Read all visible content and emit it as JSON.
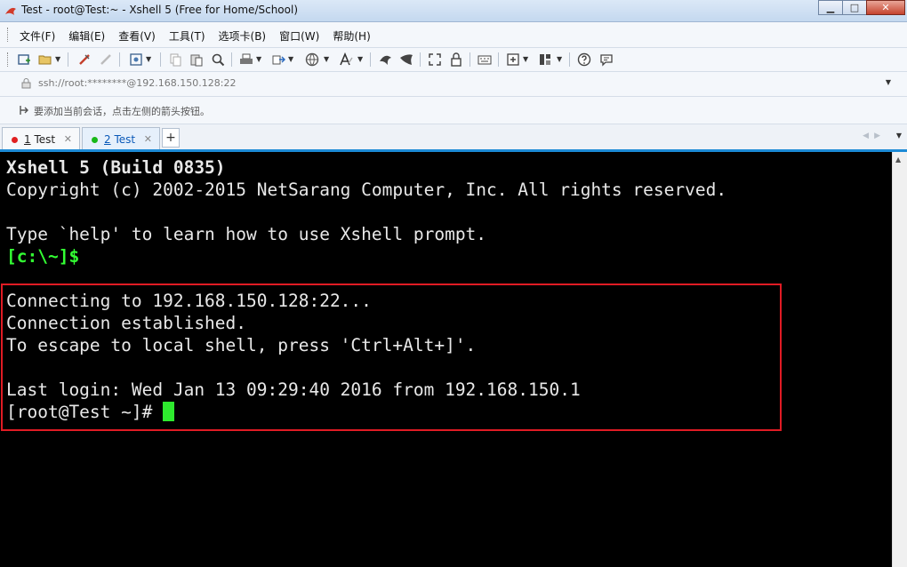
{
  "window": {
    "title": "Test - root@Test:~ - Xshell 5 (Free for Home/School)",
    "minimize_glyph": "▁",
    "maximize_glyph": "□",
    "close_glyph": "✕"
  },
  "menu": {
    "items": [
      "文件(F)",
      "编辑(E)",
      "查看(V)",
      "工具(T)",
      "选项卡(B)",
      "窗口(W)",
      "帮助(H)"
    ]
  },
  "toolbar": {
    "icons": [
      "new-session-icon",
      "open-folder-icon",
      "connect-icon",
      "disconnect-icon",
      "properties-icon",
      "copy-icon",
      "paste-icon",
      "find-icon",
      "print-icon",
      "transfer-icon",
      "globe-icon",
      "font-icon",
      "xftp-icon",
      "xagent-icon",
      "fullscreen-icon",
      "lock-icon",
      "keyboard-icon",
      "compose-icon",
      "layout-icon",
      "help-icon",
      "chat-icon"
    ]
  },
  "address": {
    "value": "ssh://root:********@192.168.150.128:22"
  },
  "hint": {
    "text": "要添加当前会话，点击左侧的箭头按钮。"
  },
  "tabs": [
    {
      "number": "1",
      "label": " Test",
      "status_color": "#e02020",
      "active": false
    },
    {
      "number": "2",
      "label": " Test",
      "status_color": "#18b818",
      "active": true
    }
  ],
  "tab_add_label": "+",
  "terminal": {
    "lines": [
      "Xshell 5 (Build 0835)",
      "Copyright (c) 2002-2015 NetSarang Computer, Inc. All rights reserved.",
      "",
      "Type `help' to learn how to use Xshell prompt.",
      "[c:\\~]$",
      "",
      "Connecting to 192.168.150.128:22...",
      "Connection established.",
      "To escape to local shell, press 'Ctrl+Alt+]'.",
      "",
      "Last login: Wed Jan 13 09:29:40 2016 from 192.168.150.1",
      "[root@Test ~]#"
    ]
  },
  "colors": {
    "terminal_bg": "#000000",
    "prompt_green": "#33ff33",
    "cursor": "#2eea2e",
    "highlight_border": "#e01b24",
    "tab_accent": "#1c8ad6"
  }
}
